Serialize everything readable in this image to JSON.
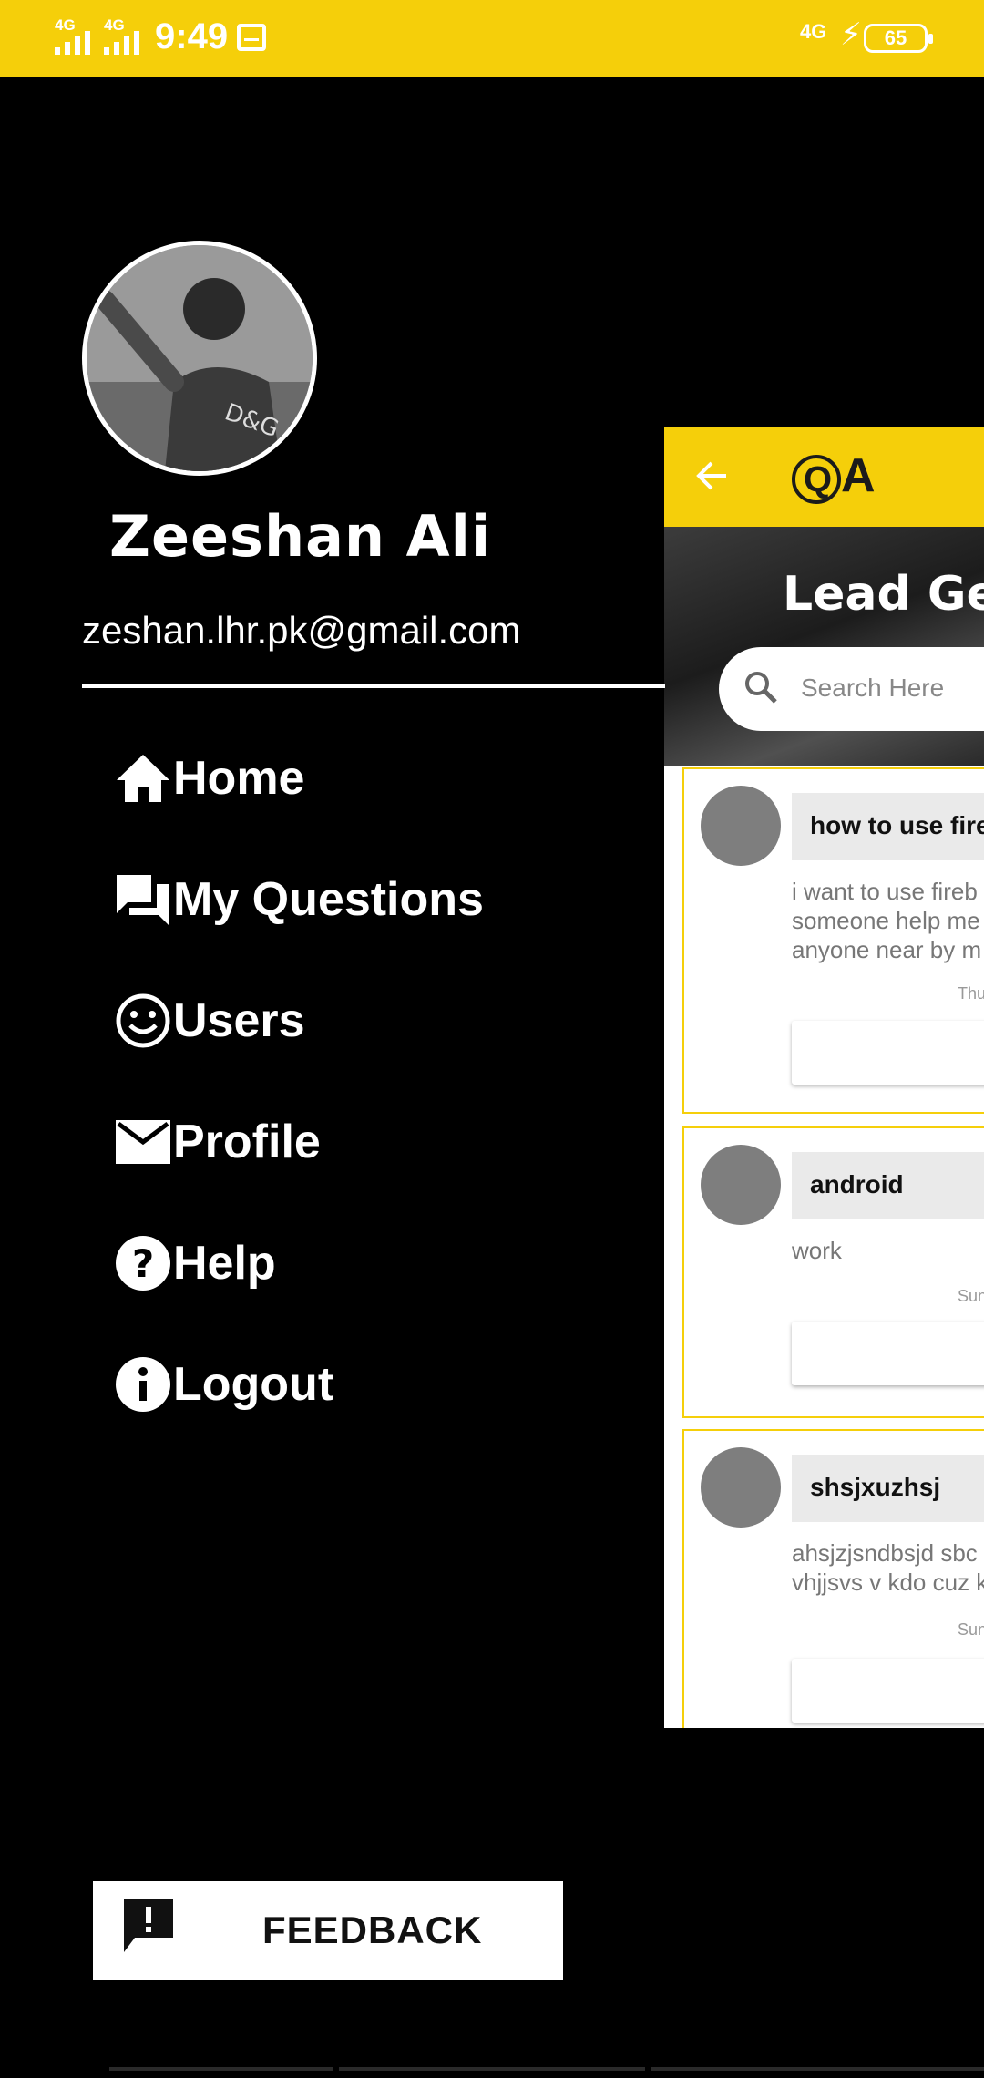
{
  "status_bar": {
    "network_left": "4G",
    "network_right": "4G",
    "time": "9:49",
    "network_right_side": "4G",
    "battery": "65"
  },
  "drawer": {
    "user_name": "Zeeshan Ali",
    "user_email": "zeshan.lhr.pk@gmail.com",
    "menu": [
      {
        "label": "Home",
        "icon": "home-icon"
      },
      {
        "label": "My Questions",
        "icon": "forum-icon"
      },
      {
        "label": "Users",
        "icon": "smiley-icon"
      },
      {
        "label": "Profile",
        "icon": "mail-icon"
      },
      {
        "label": "Help",
        "icon": "help-icon"
      },
      {
        "label": "Logout",
        "icon": "info-icon"
      }
    ],
    "feedback_label": "FEEDBACK"
  },
  "app": {
    "logo": "QA",
    "banner_title": "Lead Gen",
    "search_placeholder": "Search Here",
    "questions": [
      {
        "title": "how to use fireb",
        "body": "i want to use fireb\nsomeone help me\nanyone near by m",
        "date": "Thu"
      },
      {
        "title": "android",
        "body": "work",
        "date": "Sun"
      },
      {
        "title": "shsjxuzhsj",
        "body": "ahsjzjsndbsjd sbc\nvhjjsvs v kdo cuz k",
        "date": "Sun"
      }
    ]
  },
  "colors": {
    "accent": "#f5cf0a",
    "drawer_bg": "#000000"
  }
}
